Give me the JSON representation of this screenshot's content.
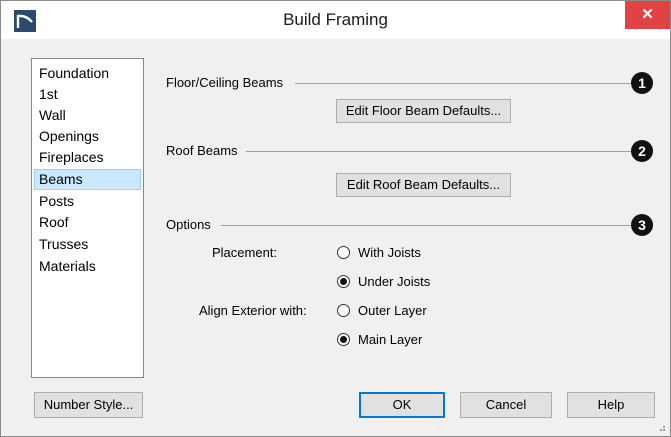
{
  "window": {
    "title": "Build Framing",
    "close_glyph": "✕"
  },
  "sidebar": {
    "items": [
      {
        "label": "Foundation",
        "selected": false
      },
      {
        "label": "1st",
        "selected": false
      },
      {
        "label": "Wall",
        "selected": false
      },
      {
        "label": "Openings",
        "selected": false
      },
      {
        "label": "Fireplaces",
        "selected": false
      },
      {
        "label": "Beams",
        "selected": true
      },
      {
        "label": "Posts",
        "selected": false
      },
      {
        "label": "Roof",
        "selected": false
      },
      {
        "label": "Trusses",
        "selected": false
      },
      {
        "label": "Materials",
        "selected": false
      }
    ]
  },
  "sections": {
    "floor": {
      "label": "Floor/Ceiling Beams",
      "marker": "1",
      "button": "Edit Floor Beam Defaults..."
    },
    "roof": {
      "label": "Roof Beams",
      "marker": "2",
      "button": "Edit Roof Beam Defaults..."
    },
    "options": {
      "label": "Options",
      "marker": "3",
      "placement": {
        "label": "Placement:",
        "options": [
          "With Joists",
          "Under Joists"
        ],
        "selected": "Under Joists"
      },
      "align": {
        "label": "Align Exterior with:",
        "options": [
          "Outer Layer",
          "Main Layer"
        ],
        "selected": "Main Layer"
      }
    }
  },
  "footer": {
    "number_style": "Number Style...",
    "ok": "OK",
    "cancel": "Cancel",
    "help": "Help"
  },
  "colors": {
    "close_button": "#e04343",
    "selection": "#cce8ff",
    "default_button_border": "#0078d7"
  }
}
